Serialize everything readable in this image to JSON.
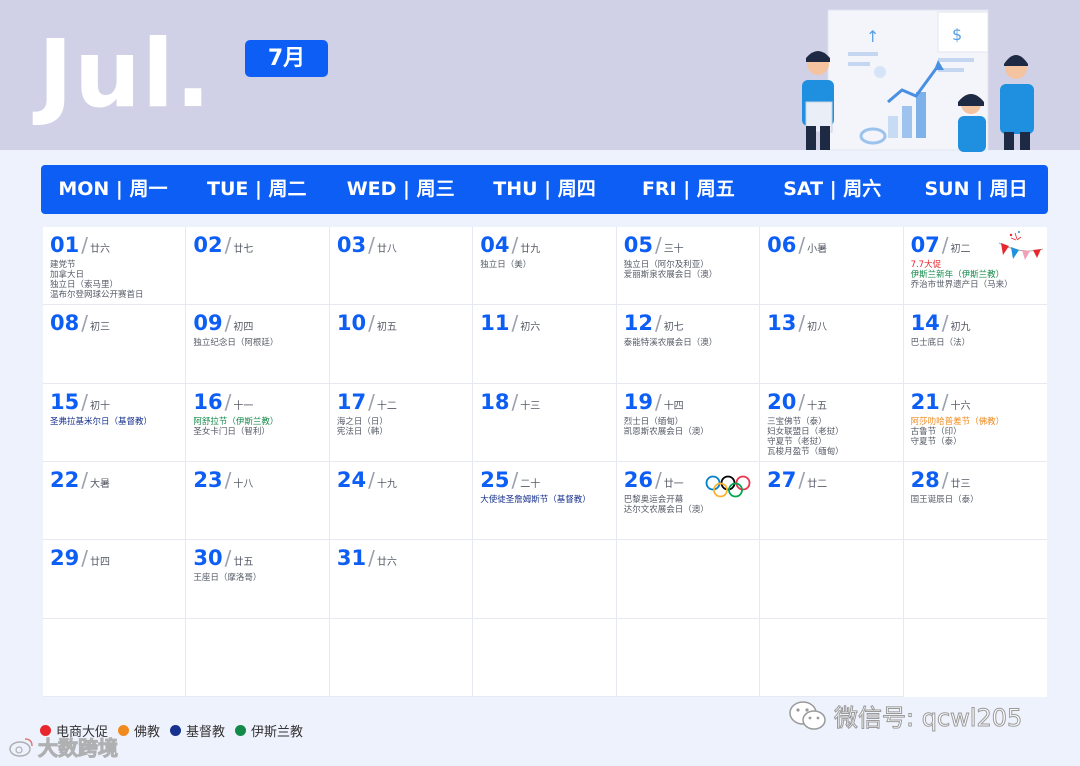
{
  "header": {
    "month_en": "Jul.",
    "month_cn": "7月"
  },
  "weekdays": [
    "MON | 周一",
    "TUE | 周二",
    "WED | 周三",
    "THU | 周四",
    "FRI | 周五",
    "SAT | 周六",
    "SUN | 周日"
  ],
  "colors": {
    "accent": "#0d5ef5",
    "ecommerce": "#e8262e",
    "buddhism": "#f08a1e",
    "christianity": "#16318e",
    "islam": "#138a4a"
  },
  "cells": [
    {
      "day": "01",
      "lunar": "廿六",
      "events": [
        {
          "t": "建党节",
          "c": ""
        },
        {
          "t": "加拿大日",
          "c": ""
        },
        {
          "t": "独立日（索马里）",
          "c": ""
        },
        {
          "t": "温布尔登网球公开赛首日",
          "c": ""
        }
      ]
    },
    {
      "day": "02",
      "lunar": "廿七",
      "events": []
    },
    {
      "day": "03",
      "lunar": "廿八",
      "events": []
    },
    {
      "day": "04",
      "lunar": "廿九",
      "events": [
        {
          "t": "独立日（美）",
          "c": ""
        }
      ]
    },
    {
      "day": "05",
      "lunar": "三十",
      "events": [
        {
          "t": "独立日（阿尔及利亚）",
          "c": ""
        },
        {
          "t": "爱丽斯泉农展会日（澳）",
          "c": ""
        }
      ]
    },
    {
      "day": "06",
      "lunar": "小暑",
      "events": []
    },
    {
      "day": "07",
      "lunar": "初二",
      "events": [
        {
          "t": "7.7大促",
          "c": "red"
        },
        {
          "t": "伊斯兰新年（伊斯兰教）",
          "c": "green"
        },
        {
          "t": "乔治市世界遗产日（马来）",
          "c": ""
        }
      ],
      "bunting": true
    },
    {
      "day": "08",
      "lunar": "初三",
      "events": []
    },
    {
      "day": "09",
      "lunar": "初四",
      "events": [
        {
          "t": "独立纪念日（阿根廷）",
          "c": ""
        }
      ]
    },
    {
      "day": "10",
      "lunar": "初五",
      "events": []
    },
    {
      "day": "11",
      "lunar": "初六",
      "events": []
    },
    {
      "day": "12",
      "lunar": "初七",
      "events": [
        {
          "t": "泰能特溪农展会日（澳）",
          "c": ""
        }
      ]
    },
    {
      "day": "13",
      "lunar": "初八",
      "events": []
    },
    {
      "day": "14",
      "lunar": "初九",
      "events": [
        {
          "t": "巴士底日（法）",
          "c": ""
        }
      ]
    },
    {
      "day": "15",
      "lunar": "初十",
      "events": [
        {
          "t": "圣弗拉基米尔日（基督教）",
          "c": "navy"
        }
      ]
    },
    {
      "day": "16",
      "lunar": "十一",
      "events": [
        {
          "t": "阿舒拉节（伊斯兰教）",
          "c": "green"
        },
        {
          "t": "圣女卡门日（智利）",
          "c": ""
        }
      ]
    },
    {
      "day": "17",
      "lunar": "十二",
      "events": [
        {
          "t": "海之日（日）",
          "c": ""
        },
        {
          "t": "宪法日（韩）",
          "c": ""
        }
      ]
    },
    {
      "day": "18",
      "lunar": "十三",
      "events": []
    },
    {
      "day": "19",
      "lunar": "十四",
      "events": [
        {
          "t": "烈士日（缅甸）",
          "c": ""
        },
        {
          "t": "凯恩斯农展会日（澳）",
          "c": ""
        }
      ]
    },
    {
      "day": "20",
      "lunar": "十五",
      "events": [
        {
          "t": "三宝佛节（泰）",
          "c": ""
        },
        {
          "t": "妇女联盟日（老挝）",
          "c": ""
        },
        {
          "t": "守夏节（老挝）",
          "c": ""
        },
        {
          "t": "瓦梭月盈节（缅甸）",
          "c": ""
        }
      ]
    },
    {
      "day": "21",
      "lunar": "十六",
      "events": [
        {
          "t": "阿莎叻哈普差节（佛教）",
          "c": "orange"
        },
        {
          "t": "古鲁节（印）",
          "c": ""
        },
        {
          "t": "守夏节（泰）",
          "c": ""
        }
      ]
    },
    {
      "day": "22",
      "lunar": "大暑",
      "events": []
    },
    {
      "day": "23",
      "lunar": "十八",
      "events": []
    },
    {
      "day": "24",
      "lunar": "十九",
      "events": []
    },
    {
      "day": "25",
      "lunar": "二十",
      "events": [
        {
          "t": "大使徒圣詹姆斯节（基督教）",
          "c": "navy"
        }
      ]
    },
    {
      "day": "26",
      "lunar": "廿一",
      "events": [
        {
          "t": "巴黎奥运会开幕",
          "c": ""
        },
        {
          "t": "达尔文农展会日（澳）",
          "c": ""
        }
      ],
      "olympic": true
    },
    {
      "day": "27",
      "lunar": "廿二",
      "events": []
    },
    {
      "day": "28",
      "lunar": "廿三",
      "events": [
        {
          "t": "国王诞辰日（泰）",
          "c": ""
        }
      ]
    },
    {
      "day": "29",
      "lunar": "廿四",
      "events": []
    },
    {
      "day": "30",
      "lunar": "廿五",
      "events": [
        {
          "t": "王座日（摩洛哥）",
          "c": ""
        }
      ]
    },
    {
      "day": "31",
      "lunar": "廿六",
      "events": []
    },
    {
      "day": "",
      "lunar": "",
      "events": []
    },
    {
      "day": "",
      "lunar": "",
      "events": []
    },
    {
      "day": "",
      "lunar": "",
      "events": []
    },
    {
      "day": "",
      "lunar": "",
      "events": []
    },
    {
      "day": "",
      "lunar": "",
      "events": []
    },
    {
      "day": "",
      "lunar": "",
      "events": []
    },
    {
      "day": "",
      "lunar": "",
      "events": []
    },
    {
      "day": "",
      "lunar": "",
      "events": []
    },
    {
      "day": "",
      "lunar": "",
      "events": []
    },
    {
      "day": "",
      "lunar": "",
      "events": []
    }
  ],
  "legend": [
    {
      "label": "电商大促",
      "color": "#e8262e"
    },
    {
      "label": "佛教",
      "color": "#f08a1e"
    },
    {
      "label": "基督教",
      "color": "#16318e"
    },
    {
      "label": "伊斯兰教",
      "color": "#138a4a"
    }
  ],
  "watermark": {
    "left": "大数跨境",
    "right": "微信号: qcwl205"
  },
  "illustration": {
    "chart_symbols": [
      "↑",
      "$"
    ]
  }
}
